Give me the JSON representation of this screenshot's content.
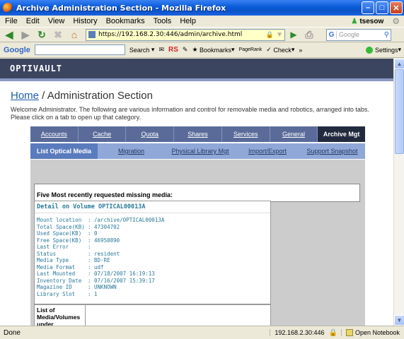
{
  "window": {
    "title": "Archive Administration Section - Mozilla Firefox"
  },
  "menu": [
    "File",
    "Edit",
    "View",
    "History",
    "Bookmarks",
    "Tools",
    "Help"
  ],
  "user": "tsesow",
  "navbar": {
    "url": "https://192.168.2.30:446/admin/archive.html",
    "search_placeholder": "Google"
  },
  "gtoolbar": {
    "logo": "Google",
    "search": "Search",
    "rs": "RS",
    "bookmarks": "Bookmarks",
    "pagerank": "PageRank",
    "check": "Check",
    "more": "»",
    "settings": "Settings"
  },
  "page": {
    "logo": "OPTIVAULT",
    "breadcrumb_home": "Home",
    "breadcrumb_sep": " / ",
    "breadcrumb_current": "Administration Section",
    "welcome": "Welcome Administrator. The following are various information and control for removable media and robotics, arranged into tabs. Please click on a tab to open up that category.",
    "tabs": [
      "Accounts",
      "Cache",
      "Quota",
      "Shares",
      "Services",
      "General",
      "Archive Mgt"
    ],
    "subtabs": [
      "List Optical Media",
      "Migration",
      "Physical Library Mgt",
      "Import/Export",
      "Support Snapshot"
    ],
    "missing_title": "Five Most recently requested missing media:",
    "detail_title": "Detail on Volume OPTICAL00013A",
    "details": [
      {
        "k": "Mount location",
        "v": ": /archive/OPTICAL00013A"
      },
      {
        "k": "Total Space(KB)",
        "v": ": 47304702"
      },
      {
        "k": "Used Space(KB)",
        "v": ": 0"
      },
      {
        "k": "Free Space(KB)",
        "v": ": 46950890"
      },
      {
        "k": "Last Error",
        "v": ":"
      },
      {
        "k": "Status",
        "v": ": resident"
      },
      {
        "k": "Media Type",
        "v": ": BD-RE"
      },
      {
        "k": "Media Format",
        "v": ": udf"
      },
      {
        "k": "Last Mounted",
        "v": ": 07/18/2007 16:19:13"
      },
      {
        "k": "Inventory Date",
        "v": ": 07/16/2007 15:39:17"
      },
      {
        "k": "Magazine ID",
        "v": ": UNKNOWN"
      },
      {
        "k": "Library Slot",
        "v": ": 1"
      }
    ],
    "list_label": "List of Media/Volumes under"
  },
  "status": {
    "text": "Done",
    "ip": "192.168.2.30:446",
    "notebook": "Open Notebook"
  }
}
